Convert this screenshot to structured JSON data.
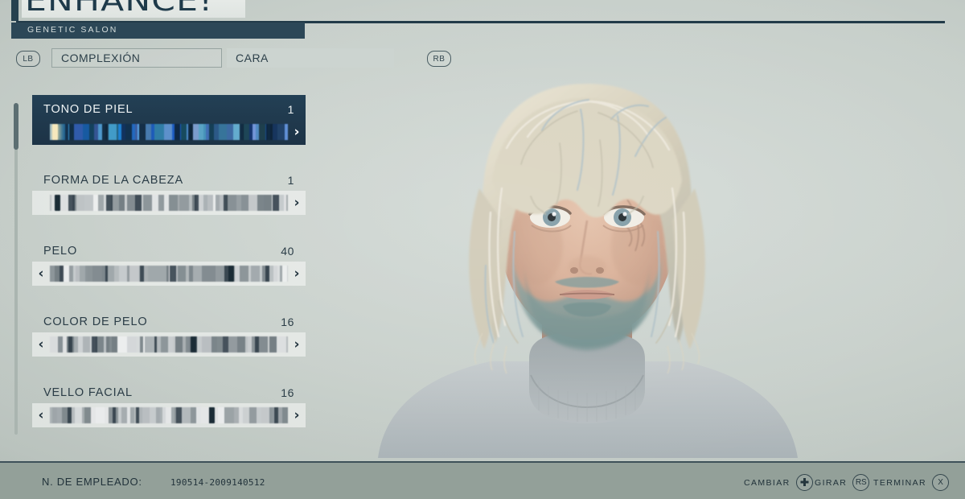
{
  "header": {
    "logo": "ENHANCE!",
    "subtitle": "GENETIC SALON"
  },
  "tabs": {
    "left_bumper": "LB",
    "right_bumper": "RB",
    "items": [
      {
        "label": "COMPLEXIÓN",
        "active": false
      },
      {
        "label": "CARA",
        "active": true
      }
    ]
  },
  "menu": {
    "items": [
      {
        "label": "TONO DE PIEL",
        "value": "1",
        "selected": true,
        "left_arrow": false,
        "right_arrow": true,
        "marker_pct": 2
      },
      {
        "label": "FORMA DE LA CABEZA",
        "value": "1",
        "selected": false,
        "left_arrow": false,
        "right_arrow": true,
        "marker_pct": 3
      },
      {
        "label": "PELO",
        "value": "40",
        "selected": false,
        "left_arrow": true,
        "right_arrow": true,
        "marker_pct": 76
      },
      {
        "label": "COLOR DE PELO",
        "value": "16",
        "selected": false,
        "left_arrow": true,
        "right_arrow": true,
        "marker_pct": 60
      },
      {
        "label": "VELLO FACIAL",
        "value": "16",
        "selected": false,
        "left_arrow": true,
        "right_arrow": true,
        "marker_pct": 68
      }
    ],
    "left_chevron_glyph": "‹",
    "right_chevron_glyph": "›"
  },
  "footer": {
    "employee_label": "N. DE EMPLEADO:",
    "employee_value": "190514-2009140512",
    "hints": [
      {
        "text": "CAMBIAR",
        "button": "dpad-icon",
        "glyph": ""
      },
      {
        "text": "GIRAR",
        "button": "rs-button",
        "glyph": "RS"
      },
      {
        "text": "TERMINAR",
        "button": "x-button",
        "glyph": "X"
      }
    ]
  },
  "colors": {
    "background": "#c7cfca",
    "panel_dark": "#1d3346",
    "accent_bar": "#2c4757",
    "text_dark": "#2b3d47",
    "footer_bg": "#93a099",
    "marker_warm": "#f6e8bd",
    "slider_blue": "#2e6f9e"
  },
  "character": {
    "name": "character-portrait",
    "hair_color": "#cfc9b6",
    "skin_color": "#d8b49e",
    "beard_color": "#7e9a99",
    "shirt_color": "#b9bfc2"
  }
}
